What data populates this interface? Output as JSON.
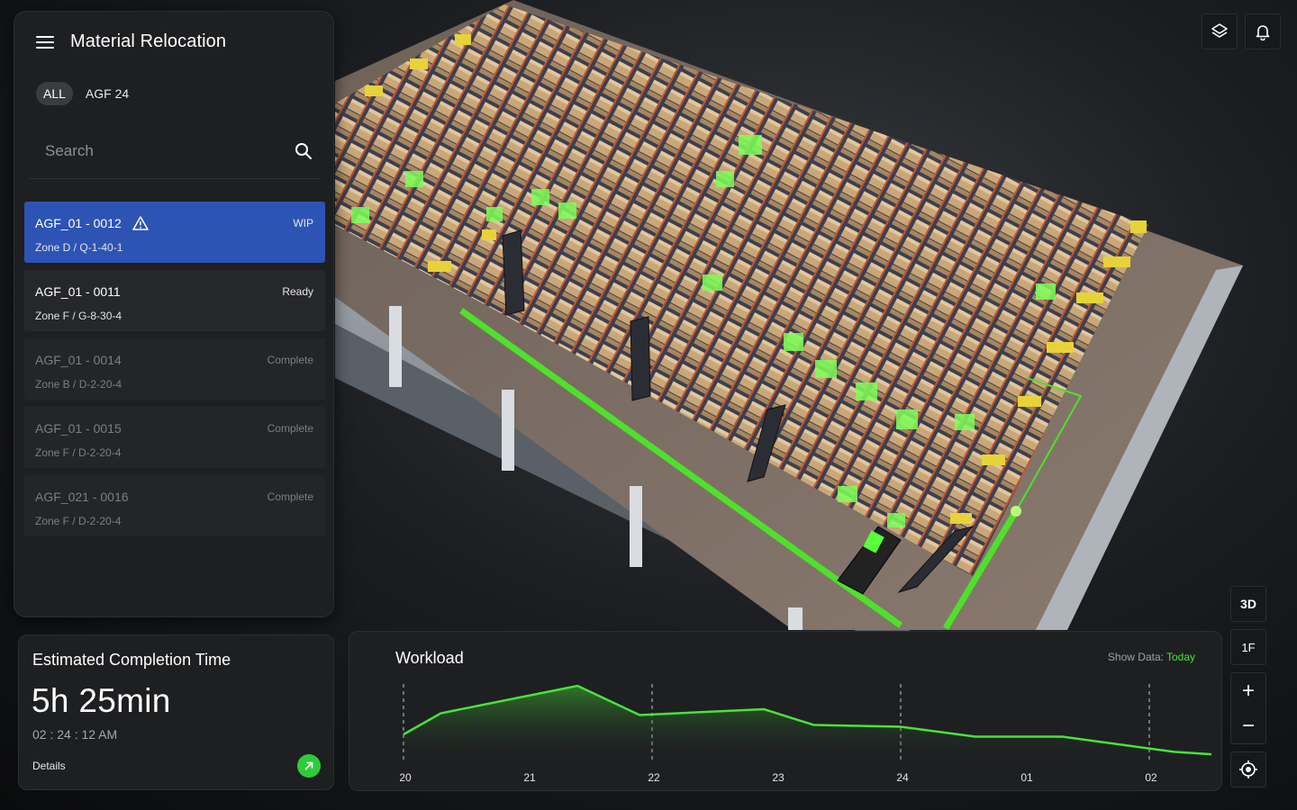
{
  "app": {
    "title": "Material Relocation"
  },
  "filters": [
    {
      "label": "ALL",
      "active": true
    },
    {
      "label": "AGF 24",
      "active": false
    }
  ],
  "search": {
    "placeholder": "Search",
    "value": ""
  },
  "tasks": [
    {
      "id": "AGF_01 - 0012",
      "location": "Zone D / Q-1-40-1",
      "status": "WIP",
      "selected": true,
      "warning": true
    },
    {
      "id": "AGF_01 - 0011",
      "location": "Zone F / G-8-30-4",
      "status": "Ready",
      "selected": false,
      "warning": false
    },
    {
      "id": "AGF_01 - 0014",
      "location": "Zone B / D-2-20-4",
      "status": "Complete",
      "selected": false,
      "warning": false
    },
    {
      "id": "AGF_01 - 0015",
      "location": "Zone F / D-2-20-4",
      "status": "Complete",
      "selected": false,
      "warning": false
    },
    {
      "id": "AGF_021 - 0016",
      "location": "Zone F / D-2-20-4",
      "status": "Complete",
      "selected": false,
      "warning": false
    }
  ],
  "eta": {
    "title": "Estimated Completion Time",
    "value": "5h 25min",
    "clock": "02 : 24 : 12 AM",
    "details_label": "Details"
  },
  "workload": {
    "title": "Workload",
    "show_data_label": "Show Data:",
    "show_data_value": "Today"
  },
  "chart_data": {
    "type": "area",
    "title": "Workload",
    "xlabel": "",
    "ylabel": "",
    "tick_labels": [
      "20",
      "21",
      "22",
      "23",
      "24",
      "01",
      "02"
    ],
    "x": [
      20.0,
      20.3,
      21.4,
      21.9,
      22.9,
      23.3,
      24.0,
      24.6,
      25.3,
      26.2,
      26.5
    ],
    "values": [
      0.17,
      0.53,
      1.0,
      0.5,
      0.6,
      0.33,
      0.3,
      0.13,
      0.13,
      -0.13,
      -0.17
    ],
    "dashed_ticks": [
      "20",
      "22",
      "24",
      "02"
    ],
    "color": "#48e33a",
    "grid": false,
    "legend": "none"
  },
  "controls": {
    "view_mode": "3D",
    "floor": "1F",
    "zoom_in": "+",
    "zoom_out": "−"
  },
  "toolbar_icons": [
    "layers-icon",
    "bell-icon"
  ],
  "colors": {
    "accent_green": "#48e33a",
    "selected_blue": "#2d54b5",
    "panel_bg": "#1e1f21"
  }
}
